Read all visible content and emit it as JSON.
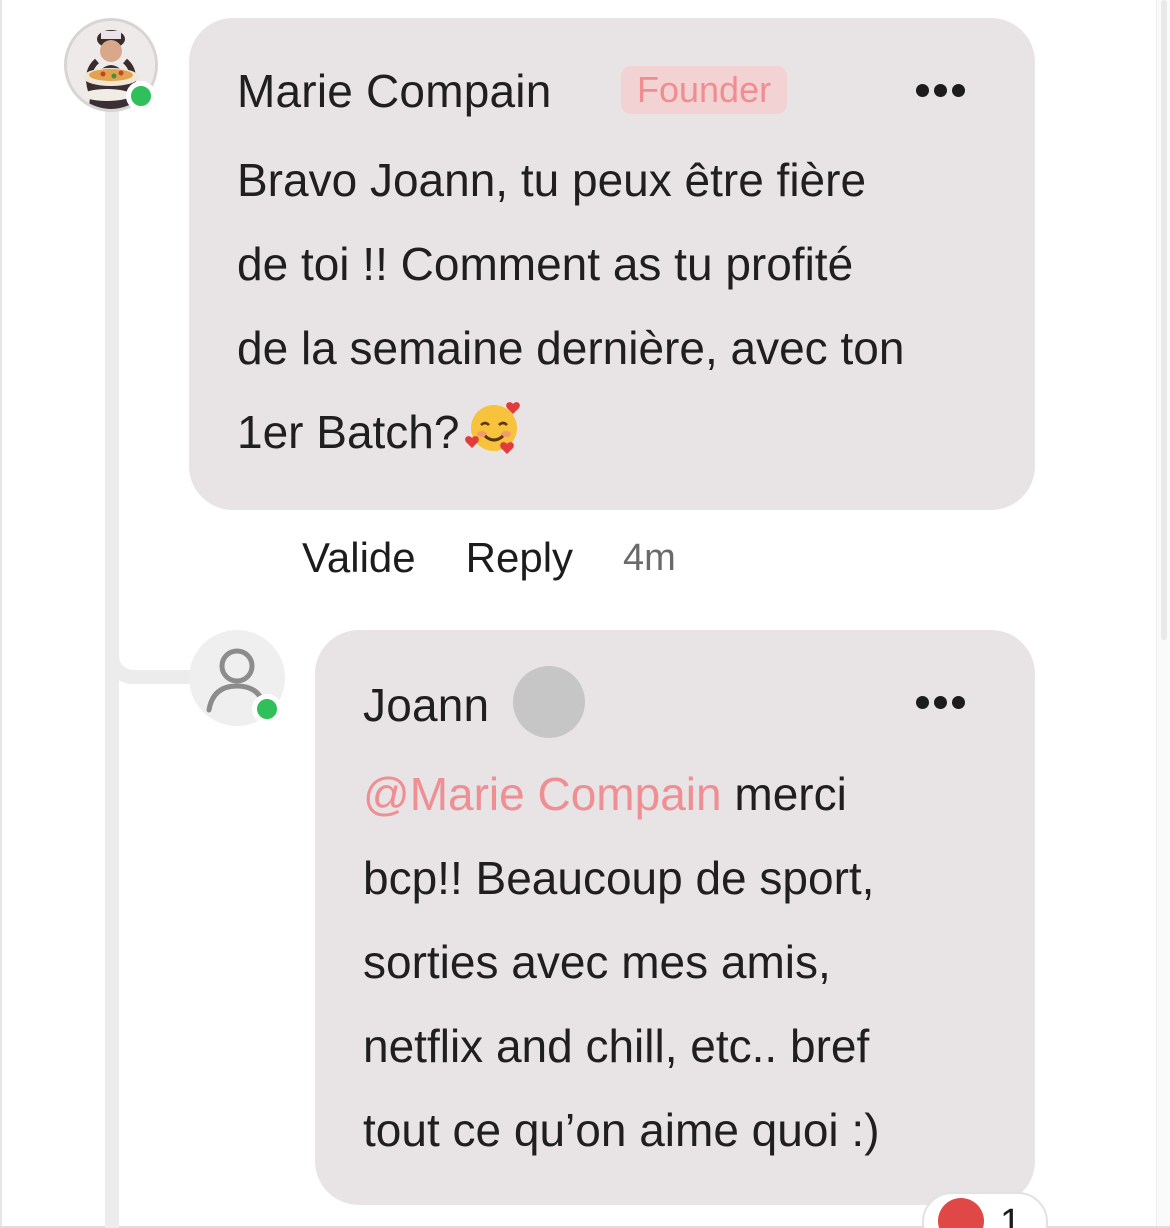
{
  "comment": {
    "author": "Marie Compain",
    "badge": "Founder",
    "lines": [
      "Bravo Joann, tu peux être fière",
      "de toi !! Comment as tu profité",
      "de la semaine dernière, avec ton",
      "1er Batch?"
    ],
    "emoji": "smiling-face-with-hearts",
    "actions": {
      "like_label": "Valide",
      "reply_label": "Reply"
    },
    "timestamp": "4m"
  },
  "reply": {
    "author": "Joann",
    "mention": "@Marie Compain",
    "lines": [
      " merci",
      "bcp!! Beaucoup de sport,",
      "sorties avec mes amis,",
      "netflix and chill, etc.. bref",
      "tout ce qu’on aime quoi :)"
    ],
    "reaction": {
      "icon": "heart-icon",
      "count": "1"
    }
  },
  "colors": {
    "bubble": "#e8e3e4",
    "badge_bg": "#f3d2d3",
    "badge_text": "#ef8d90",
    "mention": "#ee8f94",
    "online": "#2fc05a"
  }
}
